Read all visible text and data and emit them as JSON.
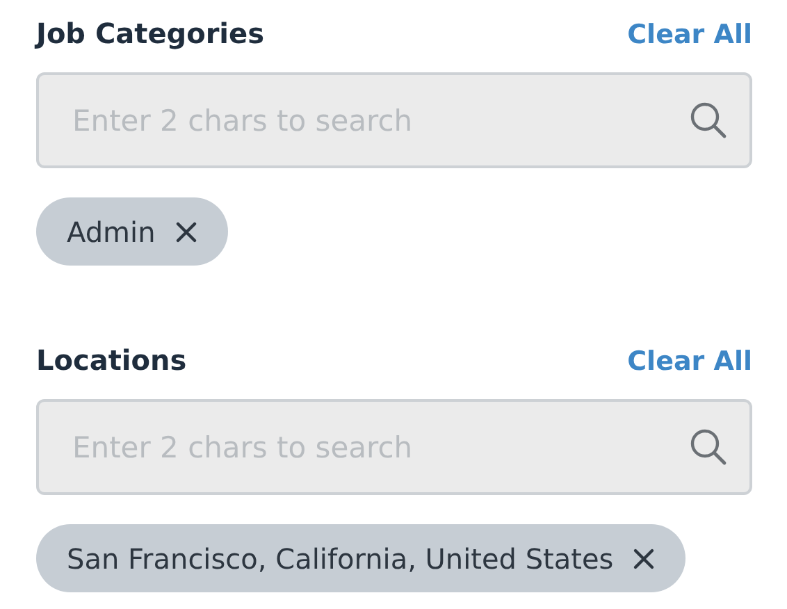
{
  "sections": [
    {
      "title": "Job Categories",
      "clear_label": "Clear All",
      "search": {
        "placeholder": "Enter 2 chars to search"
      },
      "chips": [
        {
          "label": "Admin"
        }
      ]
    },
    {
      "title": "Locations",
      "clear_label": "Clear All",
      "search": {
        "placeholder": "Enter 2 chars to search"
      },
      "chips": [
        {
          "label": "San Francisco, California, United States"
        }
      ]
    }
  ]
}
